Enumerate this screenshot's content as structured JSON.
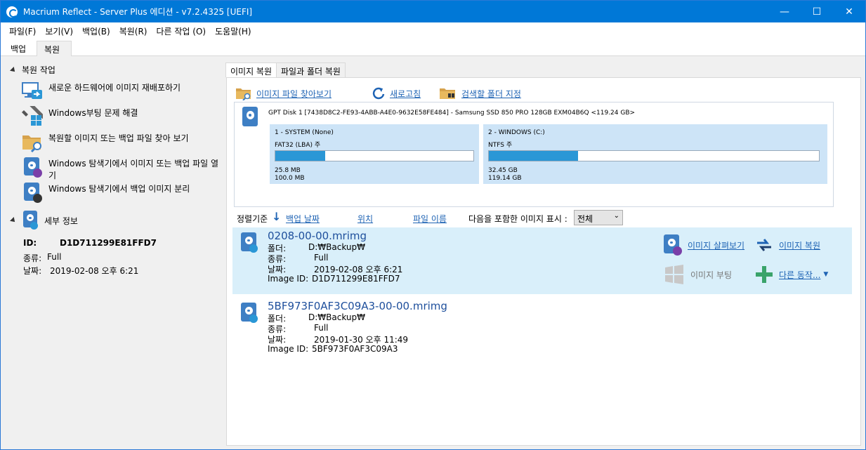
{
  "window": {
    "title": "Macrium Reflect - Server Plus 에디션 - v7.2.4325  [UEFI]",
    "minimize_glyph": "—",
    "maximize_glyph": "☐",
    "close_glyph": "✕"
  },
  "menu": [
    "파일(F)",
    "보기(V)",
    "백업(B)",
    "복원(R)",
    "다른 작업 (O)",
    "도움말(H)"
  ],
  "top_tabs": [
    "백업",
    "복원"
  ],
  "left": {
    "restore_tasks_header": "복원 작업",
    "tasks": [
      {
        "label": "새로운 하드웨어에 이미지 재배포하기",
        "icon": "monitor-redeploy-icon"
      },
      {
        "label": "Windows부팅 문제 해결",
        "icon": "wrench-windows-icon"
      },
      {
        "label": "복원할 이미지 또는 백업 파일 찾아 보기",
        "icon": "folder-search-icon"
      },
      {
        "label": "Windows 탐색기에서 이미지 또는 백업 파일 열기",
        "icon": "disk-browse-icon"
      },
      {
        "label": "Windows 탐색기에서 백업 이미지 분리",
        "icon": "disk-detach-icon"
      }
    ],
    "details_header": "세부 정보",
    "details": {
      "id_label": "ID:",
      "id_value": "D1D711299E81FFD7",
      "type_label": "종류:",
      "type_value": "Full",
      "date_label": "날짜:",
      "date_value": "2019-02-08 오후 6:21"
    }
  },
  "main": {
    "tabs": [
      "이미지 복원",
      "파일과 폴더 복원"
    ],
    "toolbar": {
      "browse": "이미지 파일 찾아보기",
      "refresh": "새로고침",
      "folders": "검색할 폴더 지정"
    },
    "disk": {
      "title": "GPT Disk 1 [7438D8C2-FE93-4ABB-A4E0-9632E58FE484] - Samsung SSD 850 PRO 128GB EXM04B6Q  <119.24 GB>",
      "partitions": [
        {
          "name": "1 - SYSTEM (None)",
          "fs": "FAT32 (LBA) 주",
          "used": "25.8 MB",
          "total": "100.0 MB",
          "fill_pct": 25
        },
        {
          "name": "2 - WINDOWS (C:)",
          "fs": "NTFS 주",
          "used": "32.45 GB",
          "total": "119.14 GB",
          "fill_pct": 27
        }
      ]
    },
    "sort": {
      "label": "정렬기준",
      "by_date": "백업 날짜",
      "by_location": "위치",
      "by_filename": "파일 이름",
      "filter_label": "다음을 포함한 이미지 표시 :",
      "filter_value": "전체"
    },
    "images": [
      {
        "name": "0208-00-00.mrimg",
        "folder_label": "폴더:",
        "folder": "D:₩Backup₩",
        "type_label": "종류:",
        "type": "Full",
        "date_label": "날짜:",
        "date": "2019-02-08 오후 6:21",
        "id_label": "Image ID:",
        "id": "D1D711299E81FFD7"
      },
      {
        "name": "5BF973F0AF3C09A3-00-00.mrimg",
        "folder_label": "폴더:",
        "folder": "D:₩Backup₩",
        "type_label": "종류:",
        "type": "Full",
        "date_label": "날짜:",
        "date": "2019-01-30 오후 11:49",
        "id_label": "Image ID:",
        "id": "5BF973F0AF3C09A3"
      }
    ],
    "actions": {
      "browse_image": "이미지 살펴보기",
      "restore_image": "이미지 복원",
      "boot_image": "이미지 부팅",
      "other_actions": "다른 동작..."
    }
  },
  "colors": {
    "titlebar": "#0078d7",
    "link": "#1e63b4",
    "selected_row": "#d9effa",
    "partition_bg": "#cde4f7",
    "partition_fill": "#2a97d6"
  }
}
